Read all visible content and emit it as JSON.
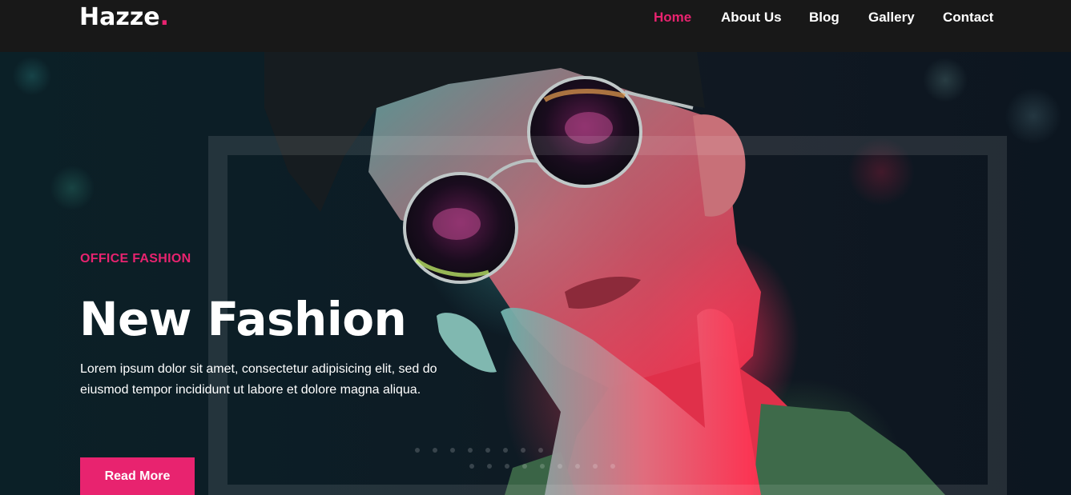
{
  "brand": {
    "name": "Hazze",
    "dot": ".",
    "accent_color": "#e8236f"
  },
  "nav": {
    "items": [
      {
        "label": "Home",
        "active": true
      },
      {
        "label": "About Us",
        "active": false
      },
      {
        "label": "Blog",
        "active": false
      },
      {
        "label": "Gallery",
        "active": false
      },
      {
        "label": "Contact",
        "active": false
      }
    ]
  },
  "hero": {
    "eyebrow": "OFFICE FASHION",
    "title": "New Fashion",
    "description": "Lorem ipsum dolor sit amet, consectetur adipisicing elit, sed do eiusmod tempor incididunt ut labore et dolore magna aliqua.",
    "button_label": "Read More",
    "image_icon": "portrait-photo"
  }
}
